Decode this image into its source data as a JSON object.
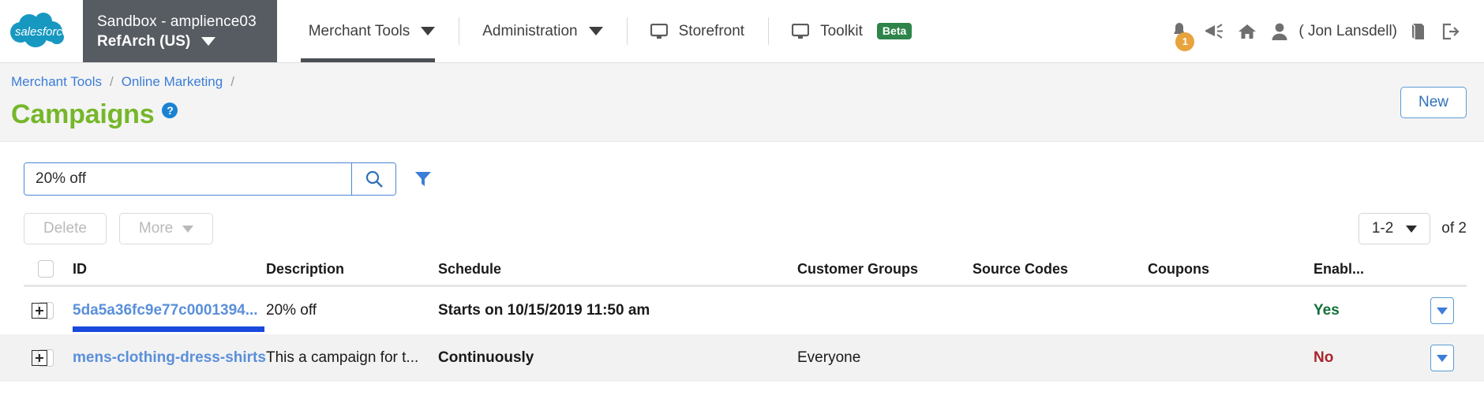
{
  "topnav": {
    "logo_text": "salesforce",
    "org": {
      "line1": "Sandbox - amplience03",
      "line2": "RefArch (US)"
    },
    "items": [
      {
        "label": "Merchant Tools",
        "icon": "chevron-down-icon",
        "active": true
      },
      {
        "label": "Administration",
        "icon": "chevron-down-icon",
        "active": false
      },
      {
        "label": "Storefront",
        "icon": "monitor-icon",
        "active": false
      },
      {
        "label": "Toolkit",
        "icon": "monitor-icon",
        "badge": "Beta",
        "active": false
      }
    ],
    "right": {
      "notification_count": "1",
      "user_label": "( Jon Lansdell)",
      "icons": [
        "bell-icon",
        "megaphone-icon",
        "home-icon",
        "user-icon",
        "book-icon",
        "logout-icon"
      ]
    }
  },
  "page": {
    "breadcrumb": [
      "Merchant Tools",
      "Online Marketing"
    ],
    "breadcrumb_sep": "/",
    "title": "Campaigns",
    "help_glyph": "?",
    "new_button": "New"
  },
  "toolbar": {
    "search_value": "20% off",
    "search_placeholder": "",
    "search_icon": "search-icon",
    "filter_icon": "filter-icon",
    "delete_label": "Delete",
    "more_label": "More",
    "pager_range": "1-2",
    "pager_of": "of 2"
  },
  "table": {
    "columns": [
      "ID",
      "Description",
      "Schedule",
      "Customer Groups",
      "Source Codes",
      "Coupons",
      "Enabl..."
    ],
    "rows": [
      {
        "id": "5da5a36fc9e77c0001394...",
        "description": "20% off",
        "schedule": "Starts on 10/15/2019 11:50 am",
        "customer_groups": "",
        "source_codes": "",
        "coupons": "",
        "enabled": "Yes",
        "enabled_state": "yes",
        "selected": true
      },
      {
        "id": "mens-clothing-dress-shirts",
        "description": "This a campaign for t...",
        "schedule": "Continuously",
        "customer_groups": "Everyone",
        "source_codes": "",
        "coupons": "",
        "enabled": "No",
        "enabled_state": "no",
        "selected": false
      }
    ]
  },
  "colors": {
    "brand_green": "#76b72a",
    "link_blue": "#3b7dd8",
    "nav_gray": "#575c62",
    "beta_green": "#2e844a",
    "yes_green": "#13713a",
    "no_red": "#a8252b",
    "badge_orange": "#e8a33d",
    "selection_blue": "#1a49dd"
  }
}
